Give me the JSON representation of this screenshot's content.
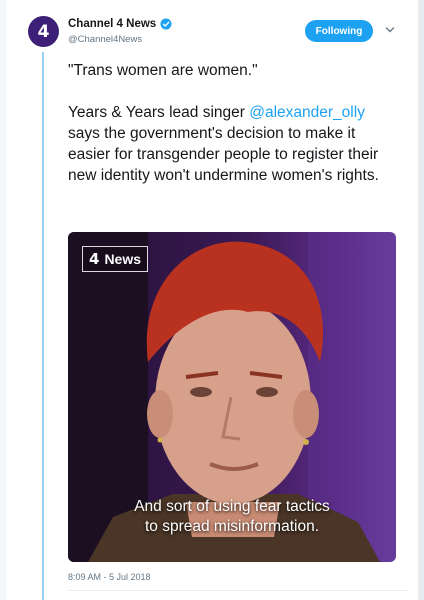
{
  "tweet": {
    "display_name": "Channel 4 News",
    "handle": "@Channel4News",
    "follow_label": "Following",
    "avatar_glyph": "4",
    "text_quote": "\"Trans women are women.\"",
    "text_before_mention": "Years & Years lead singer ",
    "mention": "@alexander_olly",
    "text_after_mention": " says the government's decision to make it easier for transgender people to register their new identity won't undermine women's rights.",
    "timestamp": "8:09 AM - 5 Jul 2018"
  },
  "media": {
    "badge_number": "4",
    "badge_word": "News",
    "subtitle_line1": "And sort of using fear tactics",
    "subtitle_line2": "to spread misinformation."
  },
  "colors": {
    "accent": "#1da1f2",
    "thread_line": "#9fd0f5",
    "avatar_bg": "#3d1f77"
  },
  "icons": {
    "verified": "verified-badge-icon",
    "caret": "chevron-down-icon"
  }
}
